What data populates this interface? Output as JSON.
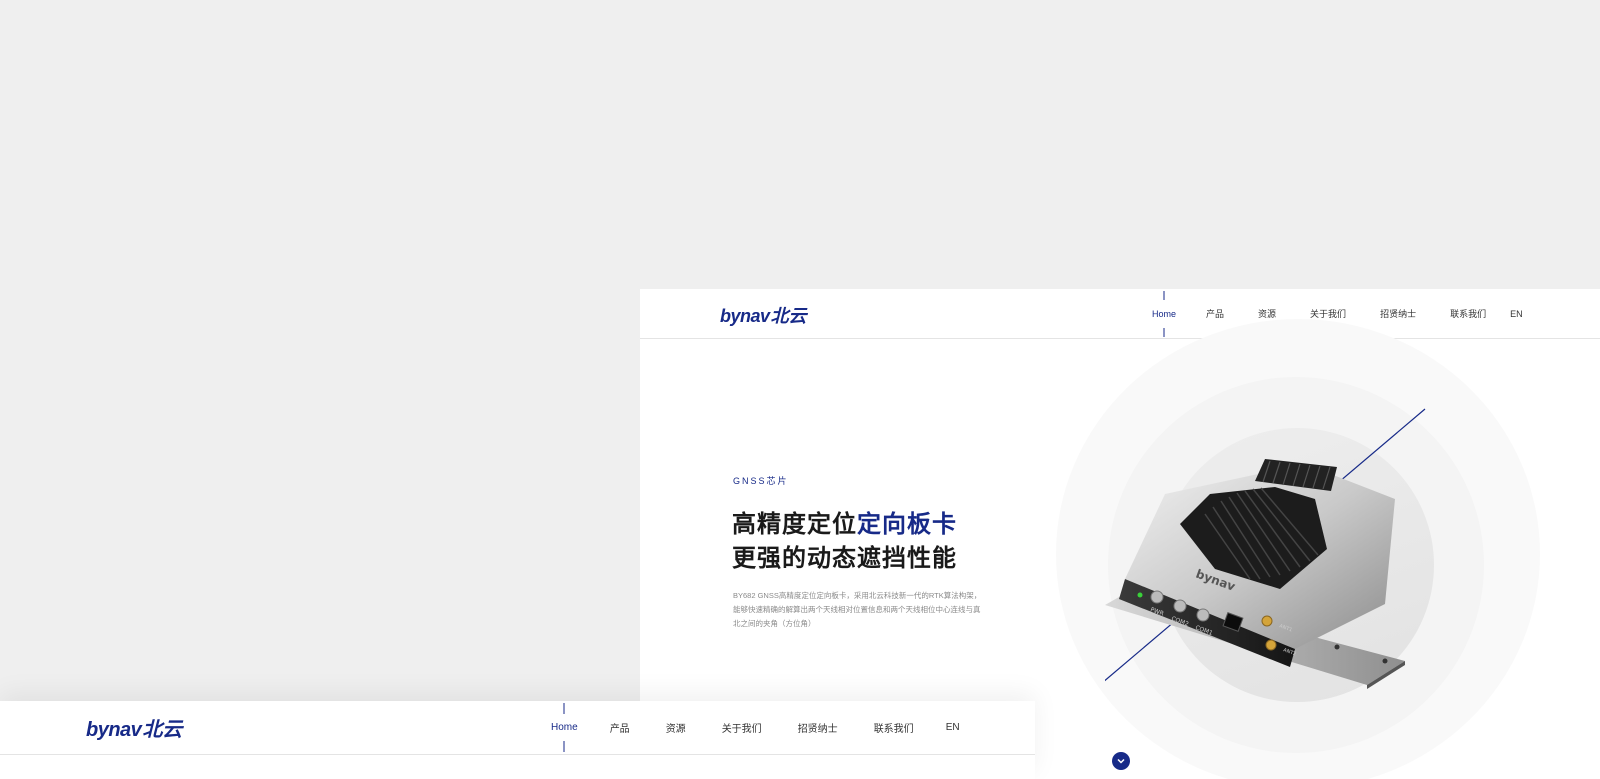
{
  "brand": {
    "logo_en": "bynav",
    "logo_cn": "北云",
    "color": "#172a88"
  },
  "nav": {
    "items": [
      {
        "label": "Home",
        "active": true
      },
      {
        "label": "产品"
      },
      {
        "label": "资源"
      },
      {
        "label": "关于我们"
      },
      {
        "label": "招贤纳士"
      },
      {
        "label": "联系我们"
      },
      {
        "label": "EN"
      }
    ]
  },
  "hero": {
    "tag": "GNSS芯片",
    "title_line1_a": "高精度定位",
    "title_line1_b": "定向板卡",
    "title_line2": "更强的动态遮挡性能",
    "desc_line1": "BY682 GNSS高精度定位定向板卡，采用北云科技新一代的RTK算法构架，",
    "desc_line2": "能够快速精确的解算出两个天线相对位置信息和两个天线相位中心连线与真",
    "desc_line3": "北之间的夹角（方位角）"
  },
  "device": {
    "brand_mark": "bynav",
    "ports": [
      "PWR",
      "COM2",
      "COM1"
    ],
    "antennas": [
      "ANT1",
      "ANT2"
    ]
  },
  "icons": {
    "scroll": "chevron-down-icon"
  }
}
